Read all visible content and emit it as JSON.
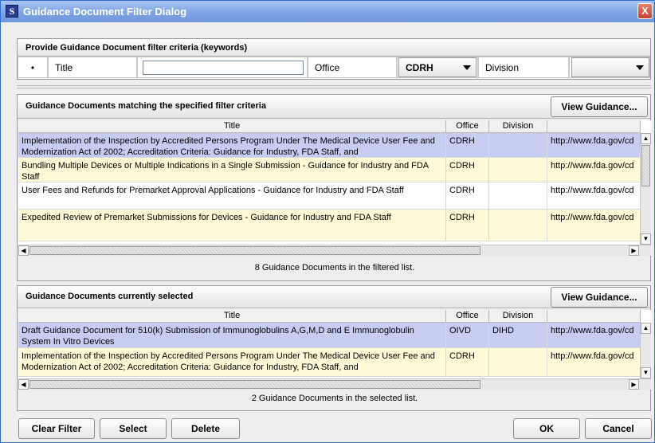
{
  "window": {
    "title": "Guidance Document Filter Dialog",
    "app_icon": "S",
    "close_glyph": "X"
  },
  "criteria": {
    "header": "Provide Guidance Document filter criteria (keywords)",
    "bullet": "•",
    "title_label": "Title",
    "title_value": "",
    "office_label": "Office",
    "office_value": "CDRH",
    "division_label": "Division",
    "division_value": ""
  },
  "matching": {
    "header": "Guidance Documents matching the specified filter criteria",
    "view_button": "View Guidance...",
    "columns": [
      "Title",
      "Office",
      "Division",
      ""
    ],
    "rows": [
      {
        "title": "Implementation of the Inspection by Accredited Persons Program Under The Medical Device User Fee and Modernization Act of 2002; Accreditation Criteria: Guidance for Industry, FDA Staff, and",
        "office": "CDRH",
        "division": "",
        "url": "http://www.fda.gov/cd"
      },
      {
        "title": "Bundling Multiple Devices or Multiple Indications in a Single Submission - Guidance for Industry and FDA Staff",
        "office": "CDRH",
        "division": "",
        "url": "http://www.fda.gov/cd"
      },
      {
        "title": "User Fees and Refunds for Premarket Approval Applications - Guidance for Industry and FDA Staff",
        "office": "CDRH",
        "division": "",
        "url": "http://www.fda.gov/cd"
      },
      {
        "title": "Expedited Review of Premarket Submissions for Devices - Guidance for Industry and FDA Staff",
        "office": "CDRH",
        "division": "",
        "url": "http://www.fda.gov/cd"
      }
    ],
    "count_text": "8 Guidance Documents in the filtered list."
  },
  "selected": {
    "header": "Guidance Documents currently selected",
    "view_button": "View Guidance...",
    "columns": [
      "Title",
      "Office",
      "Division",
      ""
    ],
    "rows": [
      {
        "title": "Draft Guidance Document for 510(k) Submission of Immunoglobulins A,G,M,D and E Immunoglobulin System In Vitro Devices",
        "office": "OIVD",
        "division": "DIHD",
        "url": "http://www.fda.gov/cd"
      },
      {
        "title": "Implementation of the Inspection by Accredited Persons Program Under The Medical Device User Fee and Modernization Act of 2002; Accreditation Criteria: Guidance for Industry, FDA Staff, and",
        "office": "CDRH",
        "division": "",
        "url": "http://www.fda.gov/cd"
      }
    ],
    "count_text": "2 Guidance Documents in the selected list."
  },
  "buttons": {
    "clear_filter": "Clear Filter",
    "select": "Select",
    "delete": "Delete",
    "ok": "OK",
    "cancel": "Cancel"
  },
  "scroll_glyphs": {
    "up": "▲",
    "down": "▼",
    "left": "◀",
    "right": "▶"
  },
  "colors": {
    "row_selected": "#c6ccf2",
    "row_yellow": "#fffbd9",
    "row_white": "#ffffff",
    "title_bar": "#7fa3e4"
  }
}
